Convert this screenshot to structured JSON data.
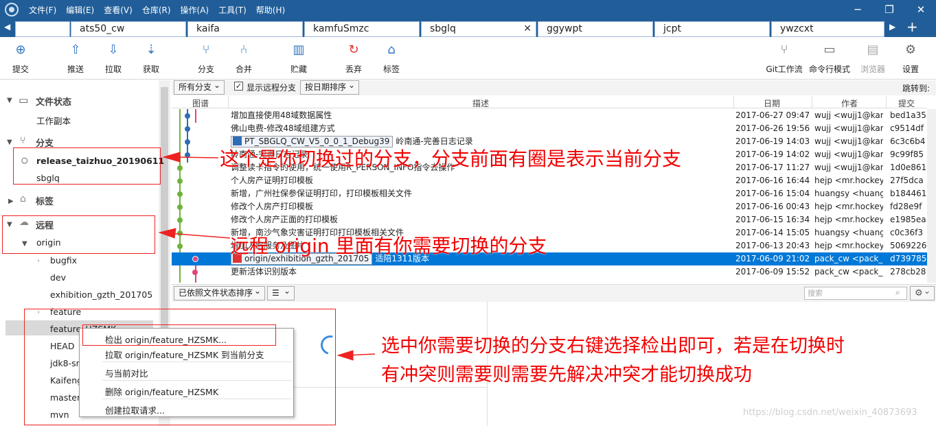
{
  "menu": [
    "文件(F)",
    "编辑(E)",
    "查看(V)",
    "仓库(R)",
    "操作(A)",
    "工具(T)",
    "帮助(H)"
  ],
  "tabs": [
    {
      "label": ""
    },
    {
      "label": "ats50_cw"
    },
    {
      "label": "kaifa"
    },
    {
      "label": "kamfuSmzc"
    },
    {
      "label": "sbglq"
    },
    {
      "label": "ggywpt"
    },
    {
      "label": "jcpt"
    },
    {
      "label": "ywzcxt"
    }
  ],
  "toolbar": {
    "left": [
      "提交",
      "推送",
      "拉取",
      "获取",
      "分支",
      "合并",
      "贮藏",
      "丢弃",
      "标签"
    ],
    "right": [
      "Git工作流",
      "命令行模式",
      "浏览器",
      "设置"
    ]
  },
  "sidebar": {
    "file_status": "文件状态",
    "working_copy": "工作副本",
    "branches": "分支",
    "branch_items": [
      "release_taizhuo_20190611",
      "sbglq"
    ],
    "tags": "标签",
    "remotes": "远程",
    "origin": "origin",
    "origin_items": [
      "bugfix",
      "dev",
      "exhibition_gzth_201705",
      "feature",
      "feature_HZSMK",
      "HEAD",
      "jdk8-sn",
      "Kaifeng",
      "master",
      "mvn"
    ]
  },
  "filter": {
    "branches": "所有分支",
    "show_remote": "显示远程分支",
    "sort": "按日期排序",
    "jump": "跳转到:"
  },
  "columns": [
    "图谱",
    "描述",
    "日期",
    "作者",
    "提交"
  ],
  "commits": [
    {
      "desc": "增加直接使用48域数据属性",
      "tag": "",
      "date": "2017-06-27 09:47",
      "author": "wujj <wujj1@kam",
      "hash": "bed1a35"
    },
    {
      "desc": "佛山电费-修改48域组建方式",
      "tag": "",
      "date": "2017-06-26 19:56",
      "author": "wujj <wujj1@kam",
      "hash": "c9514df"
    },
    {
      "desc": "岭南通-完善日志记录",
      "tag": "PT_SBGLQ_CW_V5_0_0_1_Debug39",
      "date": "2017-06-19 14:03",
      "author": "wujj <wujj1@kam",
      "hash": "6c3c6b4"
    },
    {
      "desc": "岭南通-完善日志记录",
      "tag": "",
      "date": "2017-06-19 14:02",
      "author": "wujj <wujj1@kam",
      "hash": "9c99f85"
    },
    {
      "desc": "调整读卡指令的使用，统一使用R_PERSON_INFO指令去操作",
      "tag": "",
      "date": "2017-06-17 11:27",
      "author": "wujj <wujj1@kam",
      "hash": "1d0e861"
    },
    {
      "desc": "个人房产证明打印模板",
      "tag": "",
      "date": "2017-06-16 16:44",
      "author": "hejp <mr.hockey",
      "hash": "27f5dca"
    },
    {
      "desc": "新增，广州社保参保证明打印，打印模板相关文件",
      "tag": "",
      "date": "2017-06-16 15:04",
      "author": "huangsy <huang",
      "hash": "b184461"
    },
    {
      "desc": "修改个人房产打印模板",
      "tag": "",
      "date": "2017-06-16 00:43",
      "author": "hejp <mr.hockey",
      "hash": "fd28e9f"
    },
    {
      "desc": "修改个人房产正面的打印模板",
      "tag": "",
      "date": "2017-06-15 16:34",
      "author": "hejp <mr.hockey",
      "hash": "e1985ea"
    },
    {
      "desc": "新增，南沙气象灾害证明打印打印模板相关文件",
      "tag": "",
      "date": "2017-06-14 15:05",
      "author": "huangsy <huang",
      "hash": "c0c36f3"
    },
    {
      "desc": "增加人脸服务及图片",
      "tag": "",
      "date": "2017-06-13 20:43",
      "author": "hejp <mr.hockey",
      "hash": "5069226"
    },
    {
      "desc": "适陪1311版本",
      "tag": "origin/exhibition_gzth_201705",
      "date": "2017-06-09 21:02",
      "author": "pack_cw <pack_c",
      "hash": "d739785"
    },
    {
      "desc": "更新活体识别版本",
      "tag": "",
      "date": "2017-06-09 15:52",
      "author": "pack_cw <pack_c",
      "hash": "278cb28"
    }
  ],
  "bottom": {
    "sort": "已依照文件状态排序",
    "search_placeholder": "搜索"
  },
  "context_menu": [
    "检出 origin/feature_HZSMK...",
    "拉取 origin/feature_HZSMK 到当前分支",
    "与当前对比",
    "删除 origin/feature_HZSMK",
    "创建拉取请求..."
  ],
  "annotations": {
    "a1": "这个是你切换过的分支，分支前面有圈是表示当前分支",
    "a2": "远程 origin 里面有你需要切换的分支",
    "a3_line1": "选中你需要切换的分支右键选择检出即可，若是在切换时",
    "a3_line2": "有冲突则需要则需要先解决冲突才能切换成功"
  },
  "watermark": "https://blog.csdn.net/weixin_40873693",
  "colors": {
    "titlebar": "#215e99",
    "accent": "#0078d7",
    "annotation": "#f10000"
  }
}
